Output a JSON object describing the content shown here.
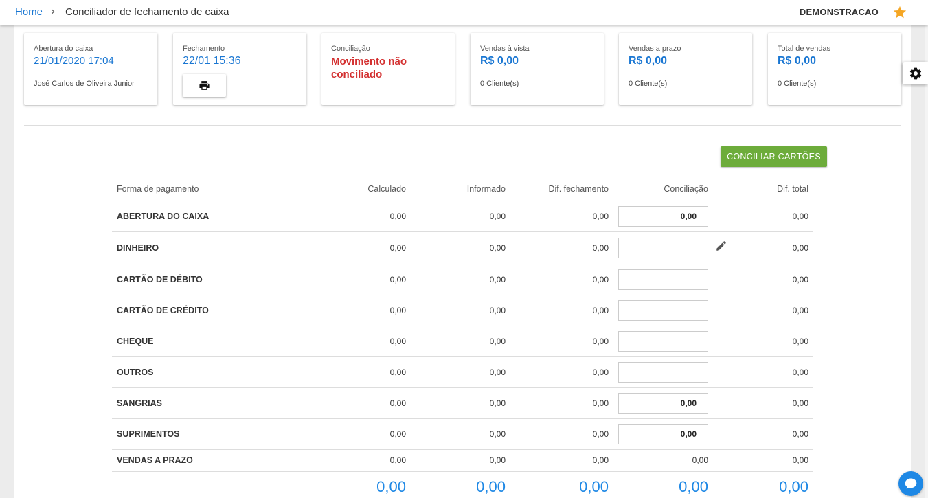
{
  "header": {
    "breadcrumb_home": "Home",
    "page_title": "Conciliador de fechamento de caixa",
    "user_name": "DEMONSTRACAO",
    "star_color": "#f5a623"
  },
  "cards": {
    "abertura": {
      "label": "Abertura do caixa",
      "value": "21/01/2020 17:04",
      "sub": "José Carlos de Oliveira Junior"
    },
    "fechamento": {
      "label": "Fechamento",
      "value": "22/01 15:36"
    },
    "conciliacao": {
      "label": "Conciliação",
      "value": "Movimento não conciliado"
    },
    "vendas_vista": {
      "label": "Vendas à vista",
      "value": "R$ 0,00",
      "sub": "0 Cliente(s)"
    },
    "vendas_prazo": {
      "label": "Vendas a prazo",
      "value": "R$ 0,00",
      "sub": "0 Cliente(s)"
    },
    "total_vendas": {
      "label": "Total de vendas",
      "value": "R$ 0,00",
      "sub": "0 Cliente(s)"
    }
  },
  "actions": {
    "conciliar_cartoes": "CONCILIAR CARTÕES"
  },
  "table": {
    "headers": [
      "Forma de pagamento",
      "Calculado",
      "Informado",
      "Dif. fechamento",
      "Conciliação",
      "Dif. total"
    ],
    "rows": [
      {
        "name": "ABERTURA DO CAIXA",
        "calculado": "0,00",
        "informado": "0,00",
        "dif_fechamento": "0,00",
        "conciliacao": "0,00",
        "dif_total": "0,00"
      },
      {
        "name": "DINHEIRO",
        "calculado": "0,00",
        "informado": "0,00",
        "dif_fechamento": "0,00",
        "conciliacao": "",
        "dif_total": "0,00"
      },
      {
        "name": "CARTÃO DE DÉBITO",
        "calculado": "0,00",
        "informado": "0,00",
        "dif_fechamento": "0,00",
        "conciliacao": "",
        "dif_total": "0,00"
      },
      {
        "name": "CARTÃO DE CRÉDITO",
        "calculado": "0,00",
        "informado": "0,00",
        "dif_fechamento": "0,00",
        "conciliacao": "",
        "dif_total": "0,00"
      },
      {
        "name": "CHEQUE",
        "calculado": "0,00",
        "informado": "0,00",
        "dif_fechamento": "0,00",
        "conciliacao": "",
        "dif_total": "0,00"
      },
      {
        "name": "OUTROS",
        "calculado": "0,00",
        "informado": "0,00",
        "dif_fechamento": "0,00",
        "conciliacao": "",
        "dif_total": "0,00"
      },
      {
        "name": "SANGRIAS",
        "calculado": "0,00",
        "informado": "0,00",
        "dif_fechamento": "0,00",
        "conciliacao": "0,00",
        "dif_total": "0,00"
      },
      {
        "name": "SUPRIMENTOS",
        "calculado": "0,00",
        "informado": "0,00",
        "dif_fechamento": "0,00",
        "conciliacao": "0,00",
        "dif_total": "0,00"
      },
      {
        "name": "VENDAS A PRAZO",
        "calculado": "0,00",
        "informado": "0,00",
        "dif_fechamento": "0,00",
        "conciliacao": "0,00",
        "dif_total": "0,00"
      }
    ],
    "totals": {
      "calculado": "0,00",
      "informado": "0,00",
      "dif_fechamento": "0,00",
      "conciliacao": "0,00",
      "dif_total": "0,00"
    }
  },
  "colors": {
    "accent_blue": "#1976d2",
    "alert_red": "#d32f2f",
    "button_green": "#6dac3b",
    "total_blue": "#1e88e5"
  }
}
